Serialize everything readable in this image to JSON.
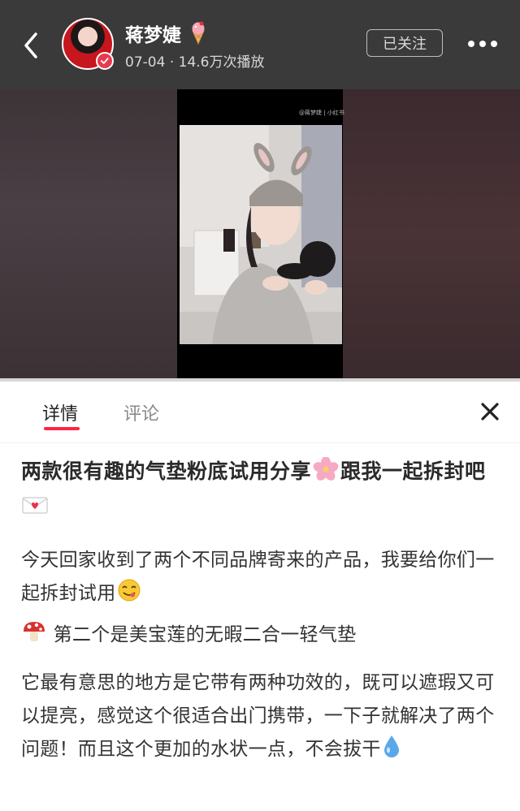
{
  "header": {
    "username": "蒋梦婕",
    "date": "07-04",
    "separator": "·",
    "play_count": "14.6万次播放",
    "follow_label": "已关注",
    "icons": {
      "back": "chevron-left-icon",
      "badge": "ice-cream-icon",
      "verified": "verified-badge-icon",
      "more": "more-dots-icon"
    }
  },
  "video": {
    "watermark": "@蒋梦婕 | 小红书"
  },
  "tabs": [
    {
      "label": "详情",
      "active": true
    },
    {
      "label": "评论",
      "active": false
    }
  ],
  "post": {
    "title": "两款很有趣的气垫粉底试用分享",
    "title_emoji_1": "cherry-blossom-icon",
    "title_cont": "跟我一起拆封吧",
    "title_emoji_2": "love-letter-icon",
    "p1": "今天回家收到了两个不同品牌寄来的产品，我要给你们一起拆封试用",
    "p1_emoji": "yum-face-icon",
    "p2_emoji": "mushroom-icon",
    "p2": "第二个是美宝莲的无暇二合一轻气垫",
    "p3": "它最有意思的地方是它带有两种功效的，既可以遮瑕又可以提亮，感觉这个很适合出门携带，一下子就解决了两个问题！而且这个更加的水状一点，不会拔干",
    "p3_emoji": "droplet-icon"
  },
  "colors": {
    "accent": "#ff2442",
    "header_bg": "#3a3a3a"
  }
}
